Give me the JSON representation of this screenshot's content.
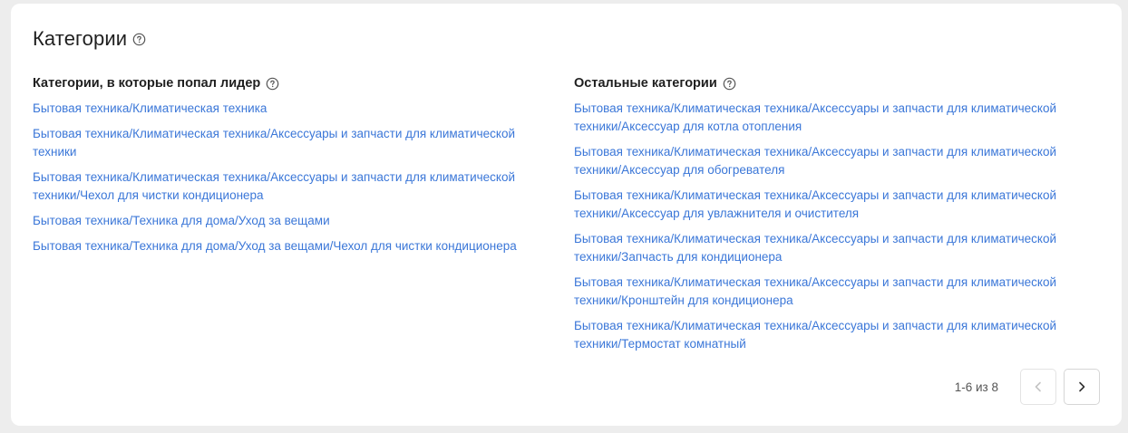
{
  "header": {
    "title": "Категории",
    "help_icon": "question-circle-icon"
  },
  "leader_categories": {
    "heading": "Категории, в которые попал лидер",
    "items": [
      "Бытовая техника/Климатическая техника",
      "Бытовая техника/Климатическая техника/Аксессуары и запчасти для климатической техники",
      "Бытовая техника/Климатическая техника/Аксессуары и запчасти для климатической техники/Чехол для чистки кондиционера",
      "Бытовая техника/Техника для дома/Уход за вещами",
      "Бытовая техника/Техника для дома/Уход за вещами/Чехол для чистки кондиционера"
    ]
  },
  "other_categories": {
    "heading": "Остальные категории",
    "items": [
      "Бытовая техника/Климатическая техника/Аксессуары и запчасти для климатической техники/Аксессуар для котла отопления",
      "Бытовая техника/Климатическая техника/Аксессуары и запчасти для климатической техники/Аксессуар для обогревателя",
      "Бытовая техника/Климатическая техника/Аксессуары и запчасти для климатической техники/Аксессуар для увлажнителя и очистителя",
      "Бытовая техника/Климатическая техника/Аксессуары и запчасти для климатической техники/Запчасть для кондиционера",
      "Бытовая техника/Климатическая техника/Аксессуары и запчасти для климатической техники/Кронштейн для кондиционера",
      "Бытовая техника/Климатическая техника/Аксессуары и запчасти для климатической техники/Термостат комнатный"
    ]
  },
  "pagination": {
    "range_text": "1-6 из 8",
    "prev_icon": "chevron-left-icon",
    "next_icon": "chevron-right-icon",
    "prev_disabled": true
  },
  "colors": {
    "link": "#3b77d8",
    "text": "#1f1f1f",
    "background": "#ededed",
    "card": "#ffffff"
  }
}
